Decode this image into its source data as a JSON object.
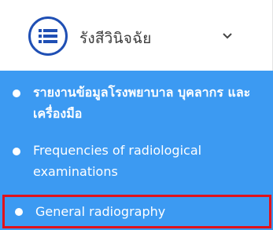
{
  "header": {
    "title": "รังสีวินิจฉัย",
    "menu_icon": "list-icon",
    "toggle_icon": "chevron-down-icon"
  },
  "submenu": {
    "items": [
      {
        "label": "รายงานข้อมูลโรงพยาบาล บุคลากร และเครื่องมือ",
        "selected": false
      },
      {
        "label": "Frequencies of radiological examinations",
        "selected": false
      },
      {
        "label": "General radiography",
        "selected": true
      }
    ]
  },
  "colors": {
    "accent_blue": "#1f4fb4",
    "submenu_bg": "#3c9af2",
    "highlight_border": "#e0121b"
  }
}
